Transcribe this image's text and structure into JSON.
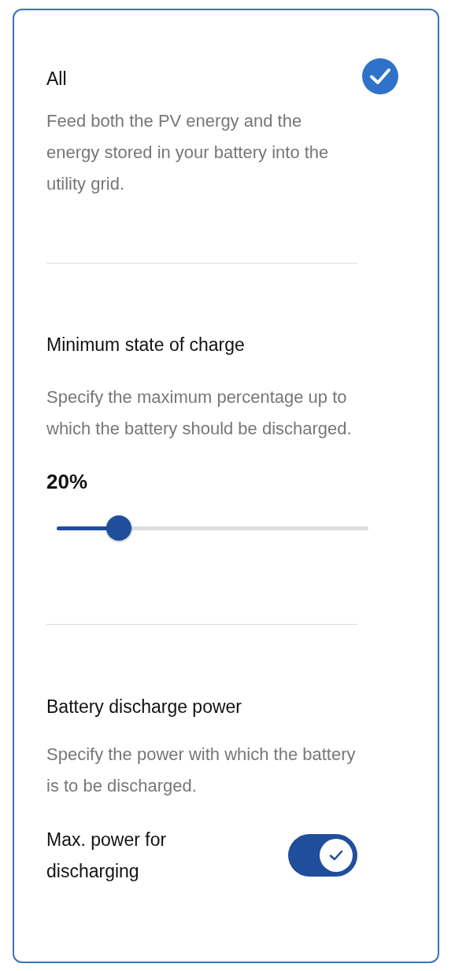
{
  "options": [
    {
      "title": "All",
      "selected": true,
      "description": "Feed both the PV energy and the energy stored in your battery into the utility grid."
    }
  ],
  "minimum_state_of_charge": {
    "title": "Minimum state of charge",
    "description": "Specify the maximum percentage up to which the battery should be discharged.",
    "value": "20%",
    "level": 0.2
  },
  "discharge_power": {
    "title": "Battery discharge power",
    "description": "Specify the power with which the battery is to be discharged.",
    "toggle": {
      "label": "Max. power for discharging",
      "on": true
    }
  }
}
